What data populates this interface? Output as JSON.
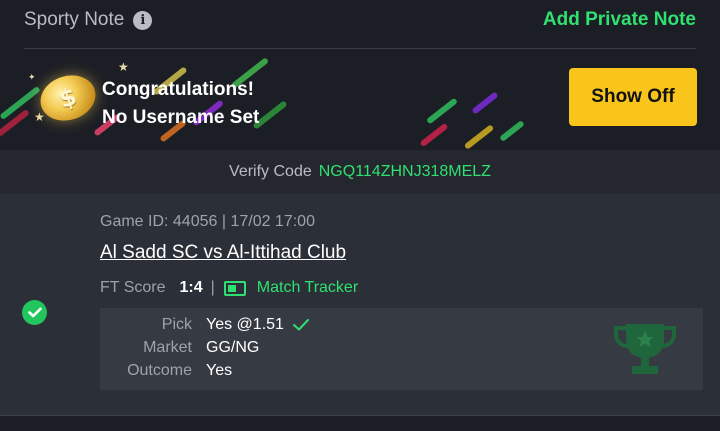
{
  "header": {
    "title": "Sporty Note",
    "action_label": "Add Private Note"
  },
  "banner": {
    "line1": "Congratulations!",
    "line2": "No Username Set",
    "button_label": "Show Off"
  },
  "verify": {
    "label": "Verify Code",
    "code": "NGQ114ZHNJ318MELZ"
  },
  "ticket": {
    "game_id": "Game ID: 44056 | 17/02 17:00",
    "teams": "Al Sadd SC vs Al-Ittihad Club",
    "ft_label": "FT Score",
    "ft_score": "1:4",
    "separator": "|",
    "tracker_label": "Match Tracker",
    "pick_label": "Pick",
    "pick_value": "Yes @1.51",
    "market_label": "Market",
    "market_value": "GG/NG",
    "outcome_label": "Outcome",
    "outcome_value": "Yes"
  },
  "colors": {
    "background": "#1b1e25",
    "accent_green": "#30e070",
    "button_yellow": "#f9c51b",
    "card": "#2b2f37"
  },
  "icons": [
    "info-icon",
    "coin-icon",
    "check-circle-icon",
    "match-tracker-icon",
    "checkmark-icon",
    "trophy-icon"
  ]
}
